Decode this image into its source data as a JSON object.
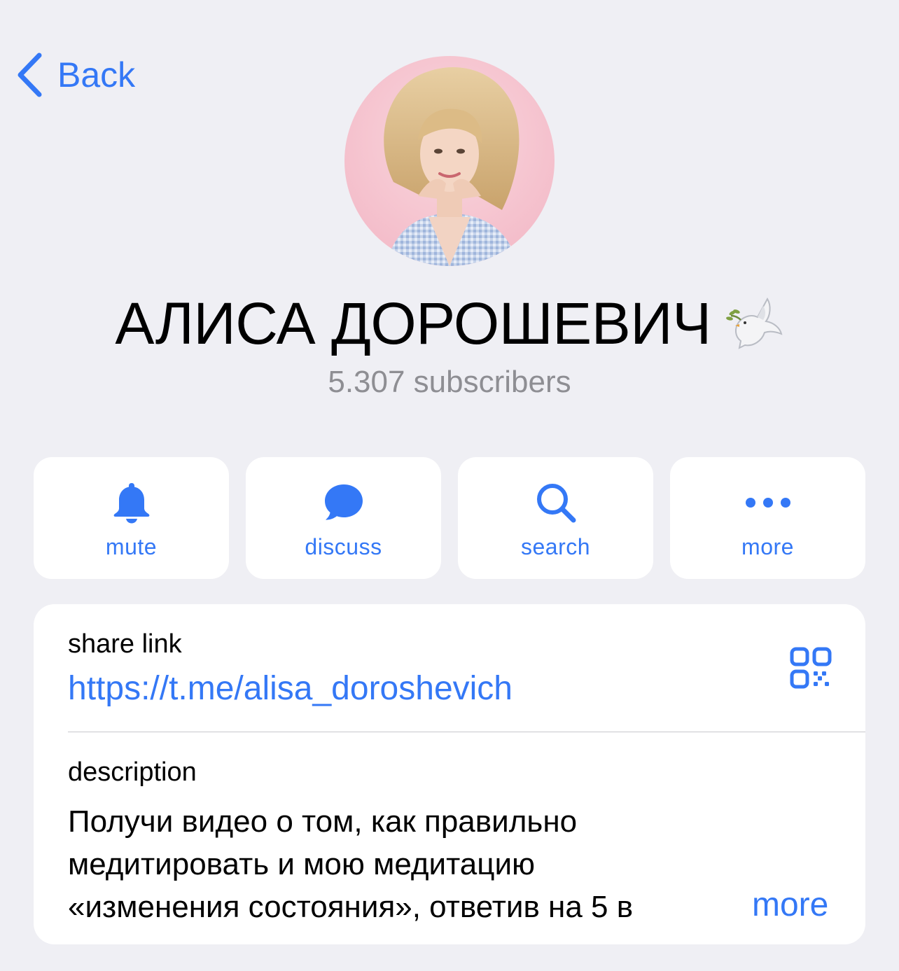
{
  "nav": {
    "back_label": "Back",
    "back_icon": "chevron-left-icon"
  },
  "profile": {
    "avatar_icon": "profile-photo",
    "name": "АЛИСА ДОРОШЕВИЧ",
    "name_emoji_icon": "dove-icon",
    "subscribers": "5.307 subscribers"
  },
  "actions": [
    {
      "label": "mute",
      "icon": "bell-icon"
    },
    {
      "label": "discuss",
      "icon": "chat-bubble-icon"
    },
    {
      "label": "search",
      "icon": "search-icon"
    },
    {
      "label": "more",
      "icon": "ellipsis-icon"
    }
  ],
  "info": {
    "share_link_label": "share link",
    "share_link_value": "https://t.me/alisa_doroshevich",
    "qr_icon": "qr-code-icon",
    "description_label": "description",
    "description_lines": [
      "Получи видео о том, как правильно",
      "медитировать и мою медитацию",
      "«изменения состояния», ответив на 5 в"
    ],
    "more_label": "more"
  },
  "colors": {
    "accent": "#3478f6",
    "background": "#efeff4",
    "secondary_text": "#8e8e93"
  }
}
